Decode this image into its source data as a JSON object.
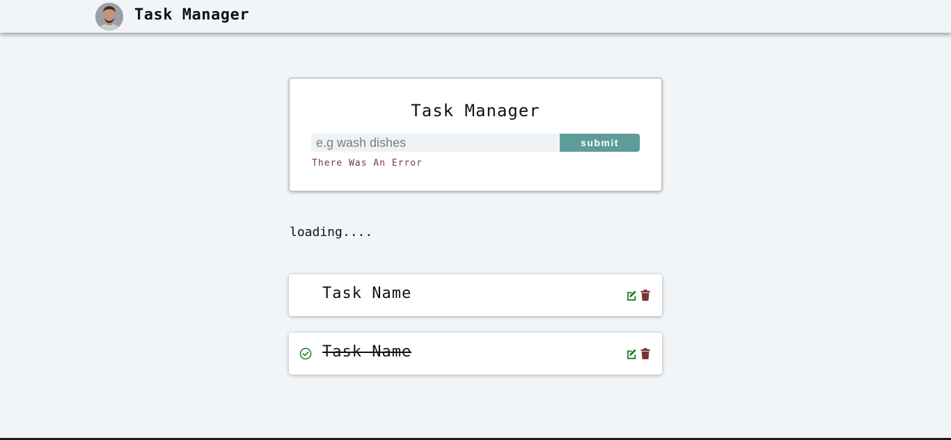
{
  "navbar": {
    "title": "Task Manager"
  },
  "form": {
    "title": "Task Manager",
    "input_placeholder": "e.g wash dishes",
    "input_value": "",
    "submit_label": "submit",
    "alert_text": "There Was An Error"
  },
  "status": {
    "loading_text": "loading...."
  },
  "tasks": [
    {
      "name": "Task Name",
      "completed": false
    },
    {
      "name": "Task Name",
      "completed": true
    }
  ],
  "colors": {
    "background": "#f1f5f8",
    "submit_button": "#5e9c9b",
    "alert_text": "#7a3b3b",
    "edit_icon": "#1e7a1e",
    "delete_icon": "#7b3434",
    "check_icon": "#1e7a1e"
  },
  "icons": {
    "edit": "edit-square-icon",
    "delete": "trash-icon",
    "completed": "check-circle-icon"
  }
}
